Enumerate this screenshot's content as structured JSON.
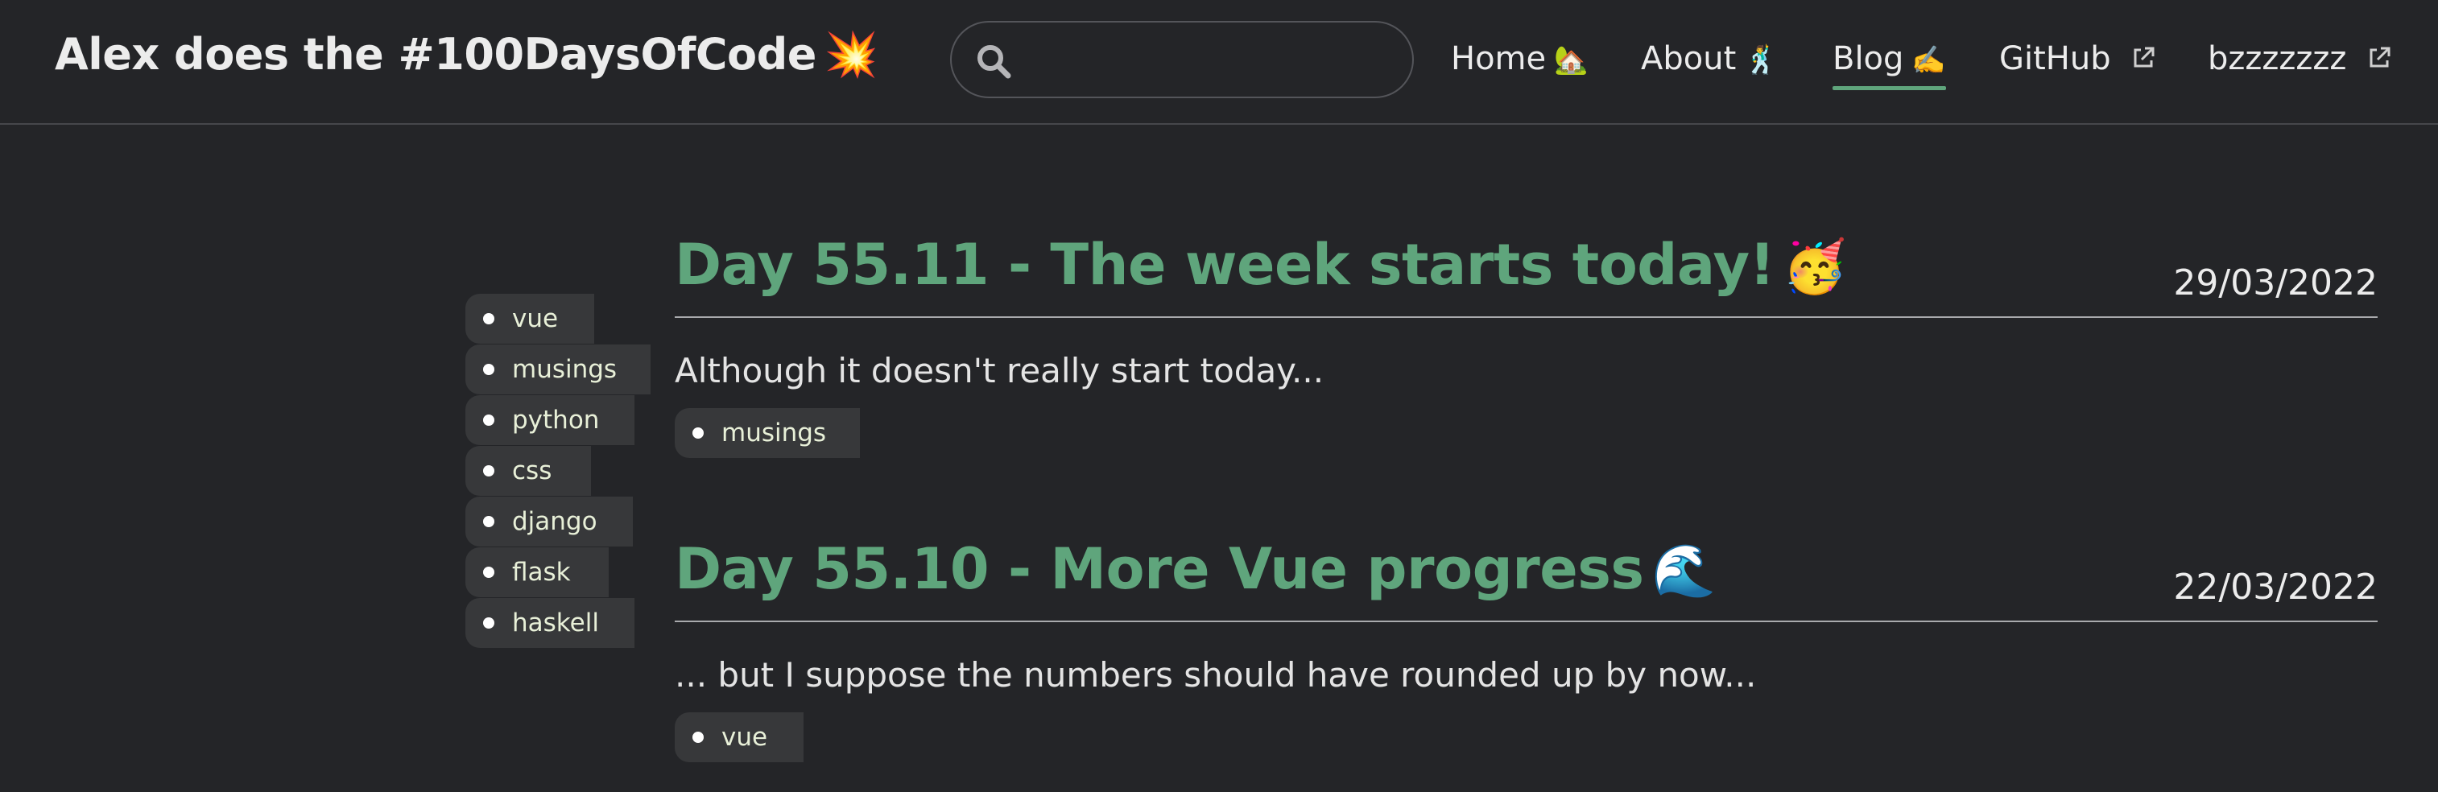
{
  "header": {
    "title": "Alex does the #100DaysOfCode",
    "title_emoji": "💥",
    "search": {
      "placeholder": "",
      "value": ""
    },
    "nav": [
      {
        "label": "Home",
        "emoji": "🏡"
      },
      {
        "label": "About",
        "emoji": "🕺"
      },
      {
        "label": "Blog",
        "emoji": "✍️"
      },
      {
        "label": "GitHub"
      },
      {
        "label": "bzzzzzzz"
      }
    ]
  },
  "tags": [
    "vue",
    "musings",
    "python",
    "css",
    "django",
    "flask",
    "haskell"
  ],
  "posts": [
    {
      "title": "Day 55.11 - The week starts today!",
      "emoji": "🥳",
      "date": "29/03/2022",
      "excerpt": "Although it doesn't really start today...",
      "tag": "musings"
    },
    {
      "title": "Day 55.10 - More Vue progress",
      "emoji": "🌊",
      "date": "22/03/2022",
      "excerpt": "... but I suppose the numbers should have rounded up by now...",
      "tag": "vue"
    }
  ],
  "colors": {
    "background": "#242528",
    "accent": "#5fa57c",
    "tag_background": "#37383a"
  }
}
